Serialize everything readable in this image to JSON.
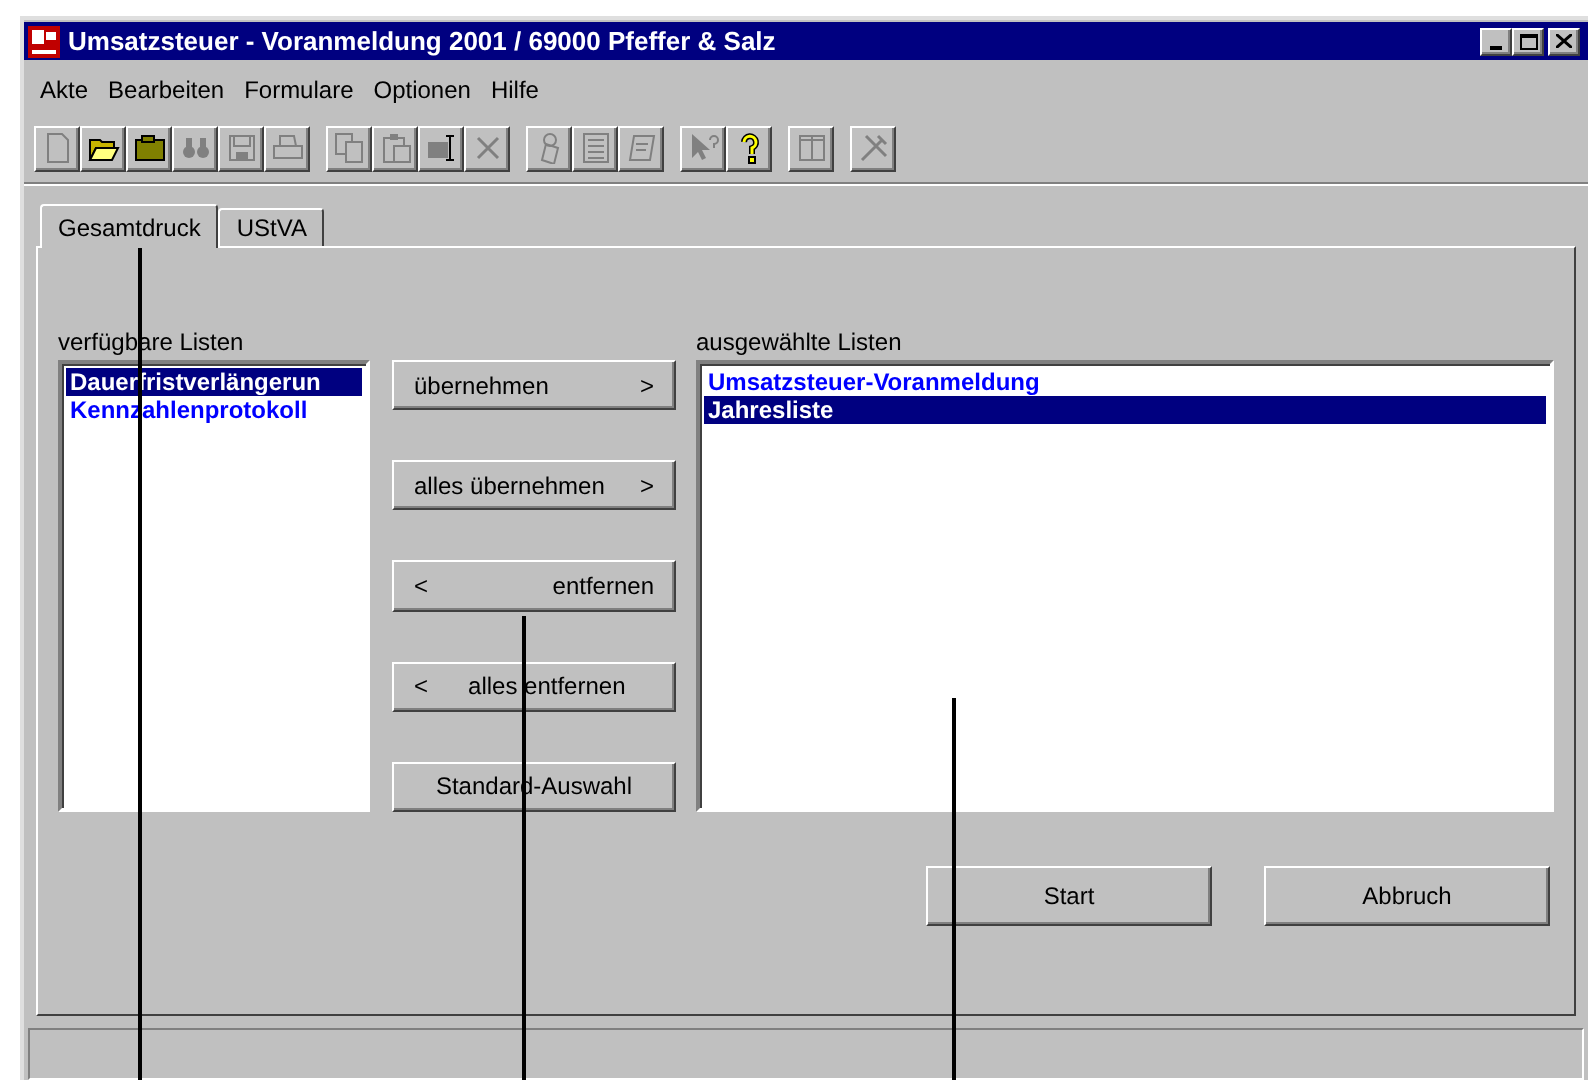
{
  "window": {
    "title": "Umsatzsteuer - Voranmeldung 2001 / 69000 Pfeffer & Salz"
  },
  "menu": [
    "Akte",
    "Bearbeiten",
    "Formulare",
    "Optionen",
    "Hilfe"
  ],
  "toolbar": [
    {
      "kind": "new",
      "disabled": true
    },
    {
      "kind": "open",
      "disabled": false
    },
    {
      "kind": "folder",
      "disabled": false
    },
    {
      "kind": "find",
      "disabled": true
    },
    {
      "kind": "save",
      "disabled": true
    },
    {
      "kind": "print",
      "disabled": true
    },
    {
      "kind": "sep"
    },
    {
      "kind": "copy",
      "disabled": true
    },
    {
      "kind": "paste",
      "disabled": true
    },
    {
      "kind": "field",
      "disabled": true
    },
    {
      "kind": "delete",
      "disabled": true
    },
    {
      "kind": "sep"
    },
    {
      "kind": "stamp",
      "disabled": true
    },
    {
      "kind": "book",
      "disabled": true
    },
    {
      "kind": "form",
      "disabled": true
    },
    {
      "kind": "sep"
    },
    {
      "kind": "pointer_help",
      "disabled": true
    },
    {
      "kind": "help",
      "disabled": false
    },
    {
      "kind": "sep"
    },
    {
      "kind": "columns",
      "disabled": true
    },
    {
      "kind": "sep"
    },
    {
      "kind": "tools",
      "disabled": true
    }
  ],
  "tabs": [
    {
      "label": "Gesamtdruck",
      "selected": true
    },
    {
      "label": "UStVA",
      "selected": false
    }
  ],
  "available": {
    "label": "verfügbare Listen",
    "items": [
      {
        "label": "Dauerfristverlängerun",
        "selected": true
      },
      {
        "label": "Kennzahlenprotokoll",
        "selected": false
      }
    ]
  },
  "move_buttons": [
    {
      "kind": "forward",
      "label": "übernehmen",
      "glyph": ">"
    },
    {
      "kind": "forward",
      "label": "alles übernehmen",
      "glyph": ">"
    },
    {
      "kind": "back",
      "label": "entfernen",
      "glyph": "<"
    },
    {
      "kind": "back_spread",
      "label": "alles entfernen",
      "glyph": "<"
    },
    {
      "kind": "plain",
      "label": "Standard-Auswahl"
    }
  ],
  "chosen": {
    "label": "ausgewählte Listen",
    "items": [
      {
        "label": "Umsatzsteuer-Voranmeldung",
        "selected": false
      },
      {
        "label": "Jahresliste",
        "selected": true
      }
    ]
  },
  "buttons": [
    "Start",
    "Abbruch"
  ]
}
